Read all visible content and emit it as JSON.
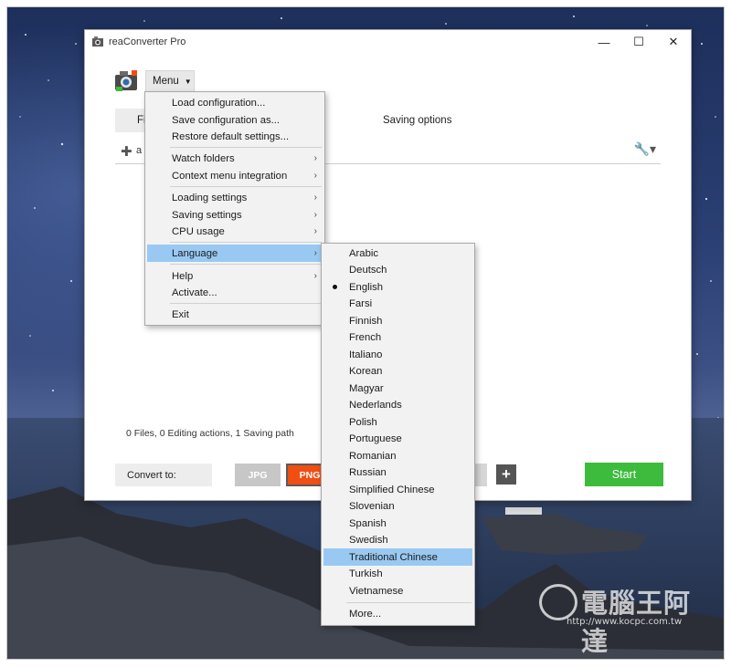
{
  "window": {
    "title": "reaConverter Pro",
    "controls": {
      "minimize": "—",
      "maximize": "☐",
      "close": "✕"
    }
  },
  "toolbar": {
    "menu_label": "Menu",
    "tab_files_partial": "Fi",
    "saving_options": "Saving options",
    "add_partial": "a"
  },
  "status": "0 Files, 0 Editing actions, 1 Saving path",
  "convert": {
    "label": "Convert to:",
    "formats": [
      "JPG",
      "PNG"
    ],
    "start_label": "Start"
  },
  "main_menu": {
    "items": [
      {
        "label": "Load configuration..."
      },
      {
        "label": "Save configuration as..."
      },
      {
        "label": "Restore default settings..."
      },
      {
        "label": "Watch folders",
        "submenu": true
      },
      {
        "label": "Context menu integration",
        "submenu": true
      },
      {
        "label": "Loading settings",
        "submenu": true
      },
      {
        "label": "Saving settings",
        "submenu": true
      },
      {
        "label": "CPU usage",
        "submenu": true
      },
      {
        "label": "Language",
        "submenu": true,
        "highlighted": true
      },
      {
        "label": "Help",
        "submenu": true
      },
      {
        "label": "Activate..."
      },
      {
        "label": "Exit"
      }
    ]
  },
  "language_menu": {
    "selected": "English",
    "highlighted": "Traditional Chinese",
    "items": [
      "Arabic",
      "Deutsch",
      "English",
      "Farsi",
      "Finnish",
      "French",
      "Italiano",
      "Korean",
      "Magyar",
      "Nederlands",
      "Polish",
      "Portuguese",
      "Romanian",
      "Russian",
      "Simplified Chinese",
      "Slovenian",
      "Spanish",
      "Swedish",
      "Traditional Chinese",
      "Turkish",
      "Vietnamese",
      "More..."
    ]
  },
  "watermark": {
    "text": "電腦王阿達",
    "url": "http://www.kocpc.com.tw"
  },
  "colors": {
    "highlight": "#99c9f2",
    "png_format": "#f04e13",
    "start_button": "#3dbb3d"
  }
}
